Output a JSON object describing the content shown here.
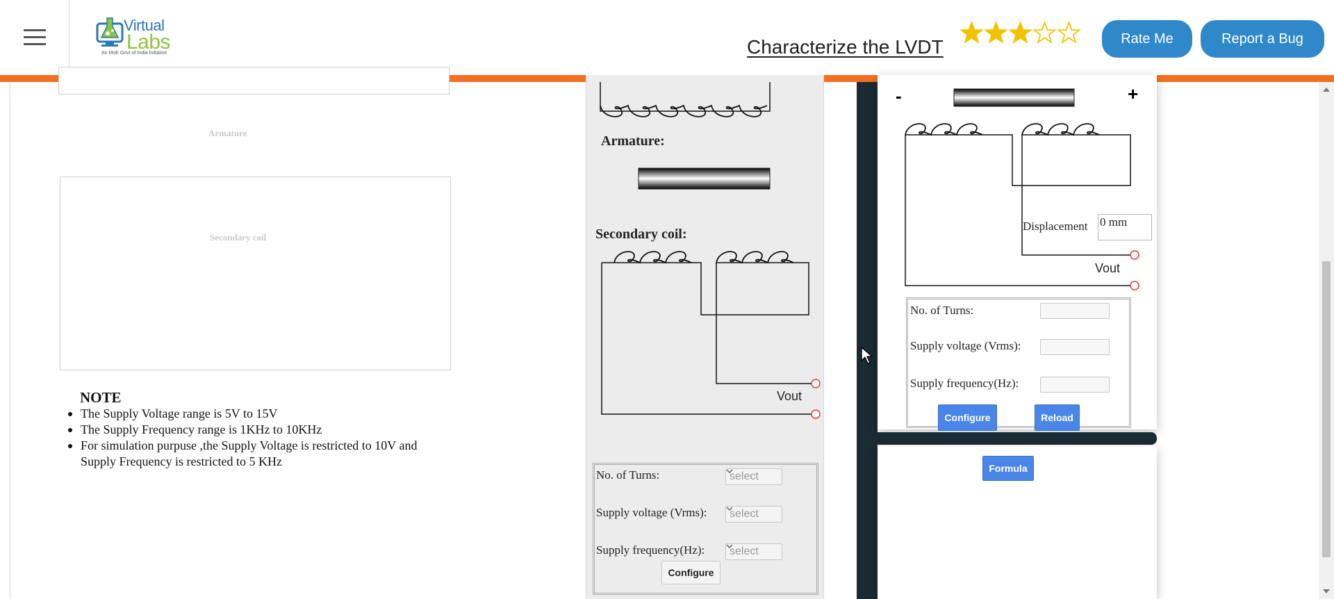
{
  "header": {
    "logo_line1": "Virtual",
    "logo_line2": "Labs",
    "logo_tagline": "An MoE Govt of India Initiative",
    "title": "Characterize the LVDT",
    "rating": {
      "value": 3,
      "max": 5
    },
    "rate_button": "Rate Me",
    "bug_button": "Report a Bug"
  },
  "left": {
    "armature_caption": "Armature",
    "secondary_caption": "Secondary coil",
    "note_title": "NOTE",
    "notes": [
      "The Supply Voltage range is 5V to 15V",
      "The Supply Frequency range is 1KHz to 10KHz",
      "For simulation purpuse ,the Supply Voltage is restricted to 10V and Supply Frequency is restricted to 5 KHz"
    ]
  },
  "middle": {
    "armature_label": "Armature:",
    "secondary_label": "Secondary coil:",
    "vout": "Vout",
    "form": {
      "turns_label": "No. of Turns:",
      "voltage_label": "Supply voltage (Vrms):",
      "frequency_label": "Supply frequency(Hz):",
      "turns_value": "select",
      "voltage_value": "select",
      "frequency_value": "select",
      "configure_button": "Configure"
    }
  },
  "right": {
    "minus": "-",
    "plus": "+",
    "displacement_label": "Displacement",
    "displacement_value": "0 mm",
    "vout": "Vout",
    "form": {
      "turns_label": "No. of Turns:",
      "voltage_label": "Supply voltage (Vrms):",
      "frequency_label": "Supply frequency(Hz):",
      "configure_button": "Configure",
      "reload_button": "Reload"
    },
    "formula_button": "Formula"
  },
  "colors": {
    "accent_orange": "#f36f21",
    "button_blue": "#2e88c9",
    "sim_button_blue": "#4a86e8",
    "star_gold": "#f2c400",
    "dark_strip": "#1b2b34"
  }
}
